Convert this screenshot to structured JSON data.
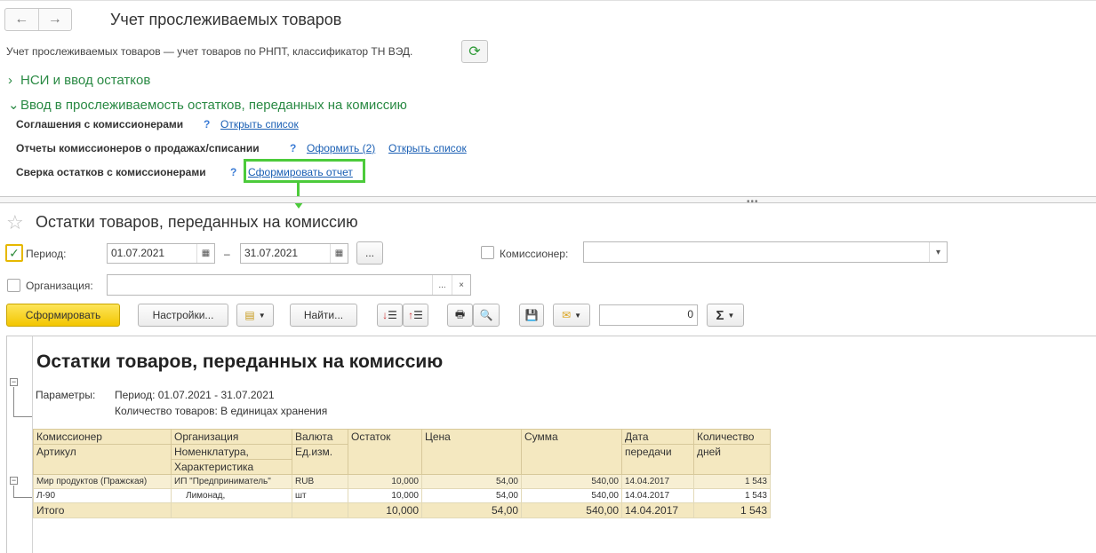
{
  "top": {
    "title": "Учет прослеживаемых товаров",
    "description": "Учет прослеживаемых товаров — учет товаров по РНПТ, классификатор ТН ВЭД."
  },
  "sections": {
    "nsi": "НСИ и ввод остатков",
    "commission": "Ввод в прослеживаемость остатков, переданных на комиссию"
  },
  "rows": {
    "agreements": {
      "label": "Соглашения с комиссионерами",
      "q": "?",
      "link1": "Открыть список"
    },
    "reports": {
      "label": "Отчеты комиссионеров о продажах/списании",
      "q": "?",
      "link1": "Оформить (2)",
      "link2": "Открыть список"
    },
    "reconcile": {
      "label": "Сверка остатков с комиссионерами",
      "q": "?",
      "link1": "Сформировать отчет"
    }
  },
  "report_form": {
    "title": "Остатки товаров, переданных на комиссию",
    "period_label": "Период:",
    "date_from": "01.07.2021",
    "dash": "–",
    "date_to": "31.07.2021",
    "ellipsis": "...",
    "commissioner_label": "Комиссионер:",
    "organization_label": "Организация:",
    "clear": "×",
    "dropdown_arrow": "▾"
  },
  "toolbar": {
    "generate": "Сформировать",
    "settings": "Настройки...",
    "find": "Найти...",
    "counter": "0",
    "sigma": "Σ"
  },
  "report": {
    "title": "Остатки товаров, переданных на комиссию",
    "params_label": "Параметры:",
    "param1": "Период: 01.07.2021 - 31.07.2021",
    "param2": "Количество товаров: В единицах хранения",
    "headers_row1": [
      "Комиссионер",
      "Организация",
      "Валюта",
      "Остаток",
      "Цена",
      "Сумма",
      "Дата",
      "Количество"
    ],
    "headers_row2": [
      "Артикул",
      "Номенклатура,",
      "Ед.изм.",
      "",
      "",
      "",
      "передачи",
      "дней"
    ],
    "headers_row3": [
      "",
      "Характеристика",
      "",
      "",
      "",
      "",
      "",
      ""
    ],
    "group_row": [
      "Мир продуктов (Пражская)",
      "ИП \"Предприниматель\"",
      "RUB",
      "10,000",
      "54,00",
      "540,00",
      "14.04.2017",
      "1 543"
    ],
    "item_row": [
      "Л-90",
      "Лимонад,",
      "шт",
      "10,000",
      "54,00",
      "540,00",
      "14.04.2017",
      "1 543"
    ],
    "total_row": [
      "Итого",
      "",
      "",
      "10,000",
      "54,00",
      "540,00",
      "14.04.2017",
      "1 543"
    ]
  }
}
